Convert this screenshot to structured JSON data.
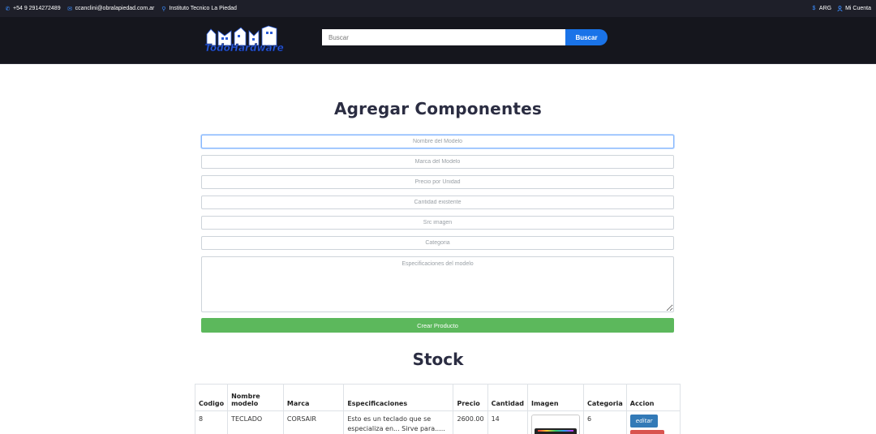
{
  "topbar": {
    "phone": "+54 9 2914272489",
    "email": "ccanclini@obralapiedad.com.ar",
    "location": "Instituto Tecnico La Piedad",
    "currency": "ARG",
    "account": "Mi Cuenta"
  },
  "header": {
    "logo_text": "TodoHardware",
    "search_placeholder": "Buscar",
    "search_button": "Buscar"
  },
  "form": {
    "title": "Agregar Componentes",
    "fields": {
      "model_name": "Nombre del Modelo",
      "model_brand": "Marca del Modelo",
      "unit_price": "Precio por Unidad",
      "quantity": "Cantidad existente",
      "image_src": "Src imagen",
      "category": "Categoria",
      "specs": "Especificaciones del modelo"
    },
    "submit": "Crear Producto"
  },
  "stock": {
    "title": "Stock",
    "columns": {
      "code": "Codigo",
      "name": "Nombre modelo",
      "brand": "Marca",
      "specs": "Especificaciones",
      "price": "Precio",
      "qty": "Cantidad",
      "image": "Imagen",
      "category": "Categoria",
      "action": "Accion"
    },
    "rows": [
      {
        "code": "8",
        "name": "TECLADO",
        "brand": "CORSAIR",
        "specs": "Esto es un teclado que se especializa en... Sirve para.....",
        "price": "2600.00",
        "qty": "14",
        "category": "6",
        "edit_label": "editar"
      }
    ]
  },
  "colors": {
    "accent": "#1a73e8",
    "topbar_bg": "#1e1f29",
    "header_bg": "#15161d",
    "create_button": "#5cb85c",
    "edit_button": "#337ab7",
    "delete_button": "#d9534f"
  }
}
